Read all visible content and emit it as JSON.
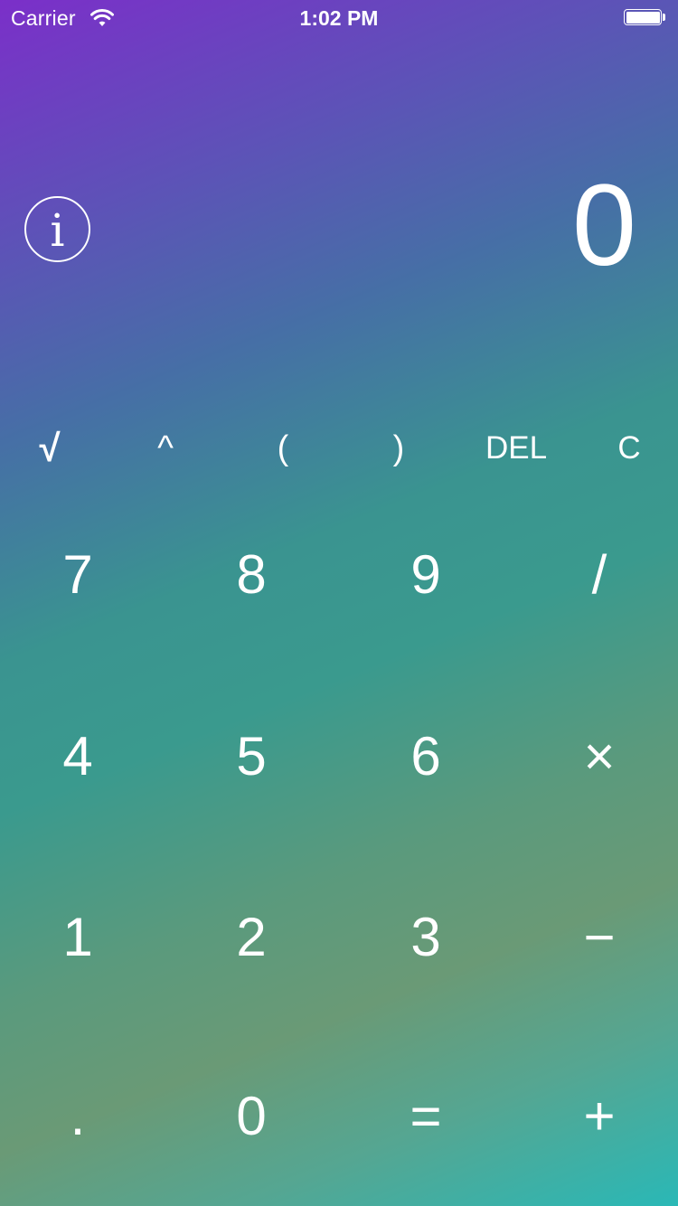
{
  "status_bar": {
    "carrier": "Carrier",
    "time": "1:02 PM",
    "wifi_icon": "wifi-icon",
    "battery_icon": "battery-full-icon"
  },
  "info_button": {
    "icon": "info-icon",
    "glyph": "i"
  },
  "display": {
    "value": "0"
  },
  "function_keys": [
    "√",
    "^",
    "(",
    ")",
    "DEL",
    "C"
  ],
  "keypad": [
    [
      "7",
      "8",
      "9",
      "/"
    ],
    [
      "4",
      "5",
      "6",
      "×"
    ],
    [
      "1",
      "2",
      "3",
      "−"
    ],
    [
      ".",
      "0",
      "=",
      "+"
    ]
  ],
  "colors": {
    "gradient_top": "#7b2fc9",
    "gradient_mid": "#3a9a8e",
    "gradient_bottom": "#2ab8b6",
    "text": "#ffffff"
  }
}
